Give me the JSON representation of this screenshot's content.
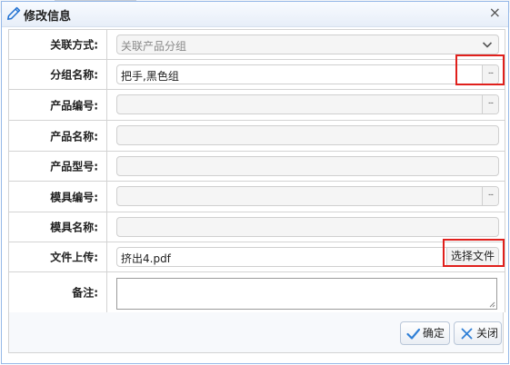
{
  "dialog": {
    "title": "修改信息",
    "title_icon": "pencil-edit-icon",
    "close_icon": "close-x-icon"
  },
  "form": {
    "fields": {
      "association": {
        "label": "关联方式:",
        "value": "关联产品分组"
      },
      "group_name": {
        "label": "分组名称:",
        "value": "把手,黑色组",
        "button_label": "..."
      },
      "product_code": {
        "label": "产品编号:",
        "value": "",
        "button_label": "..."
      },
      "product_name": {
        "label": "产品名称:",
        "value": ""
      },
      "product_model": {
        "label": "产品型号:",
        "value": ""
      },
      "mold_code": {
        "label": "模具编号:",
        "value": "",
        "button_label": "..."
      },
      "mold_name": {
        "label": "模具名称:",
        "value": ""
      },
      "file_upload": {
        "label": "文件上传:",
        "value": "挤出4.pdf",
        "button_label": "选择文件"
      },
      "remarks": {
        "label": "备注:",
        "value": ""
      }
    }
  },
  "footer": {
    "confirm_label": "确定",
    "close_label": "关闭"
  },
  "colors": {
    "highlight_border": "#e0201c",
    "dialog_border": "#95b8e7",
    "check_icon": "#2f7fd6"
  }
}
